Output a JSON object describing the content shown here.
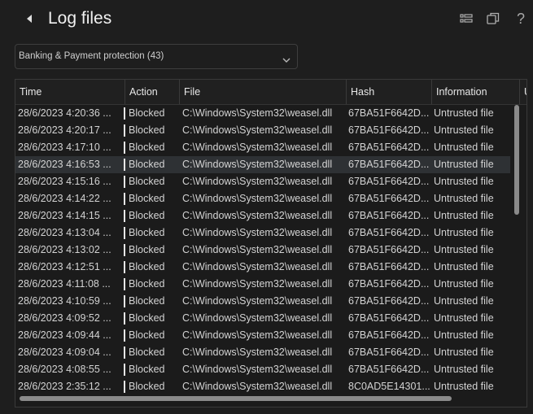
{
  "header": {
    "title": "Log files",
    "icons": [
      "back-arrow-icon",
      "list-view-icon",
      "popout-window-icon",
      "help-icon"
    ],
    "help_glyph": "?"
  },
  "filter": {
    "selected": "Banking & Payment protection (43)"
  },
  "table": {
    "columns": [
      "Time",
      "Action",
      "File",
      "Hash",
      "Information",
      "U"
    ],
    "selected_row_index": 3,
    "rows": [
      {
        "time": "28/6/2023 4:20:36 ...",
        "action": "Blocked",
        "file": "C:\\Windows\\System32\\weasel.dll",
        "hash": "67BA51F6642D...",
        "info": "Untrusted file"
      },
      {
        "time": "28/6/2023 4:20:17 ...",
        "action": "Blocked",
        "file": "C:\\Windows\\System32\\weasel.dll",
        "hash": "67BA51F6642D...",
        "info": "Untrusted file"
      },
      {
        "time": "28/6/2023 4:17:10 ...",
        "action": "Blocked",
        "file": "C:\\Windows\\System32\\weasel.dll",
        "hash": "67BA51F6642D...",
        "info": "Untrusted file"
      },
      {
        "time": "28/6/2023 4:16:53 ...",
        "action": "Blocked",
        "file": "C:\\Windows\\System32\\weasel.dll",
        "hash": "67BA51F6642D...",
        "info": "Untrusted file"
      },
      {
        "time": "28/6/2023 4:15:16 ...",
        "action": "Blocked",
        "file": "C:\\Windows\\System32\\weasel.dll",
        "hash": "67BA51F6642D...",
        "info": "Untrusted file"
      },
      {
        "time": "28/6/2023 4:14:22 ...",
        "action": "Blocked",
        "file": "C:\\Windows\\System32\\weasel.dll",
        "hash": "67BA51F6642D...",
        "info": "Untrusted file"
      },
      {
        "time": "28/6/2023 4:14:15 ...",
        "action": "Blocked",
        "file": "C:\\Windows\\System32\\weasel.dll",
        "hash": "67BA51F6642D...",
        "info": "Untrusted file"
      },
      {
        "time": "28/6/2023 4:13:04 ...",
        "action": "Blocked",
        "file": "C:\\Windows\\System32\\weasel.dll",
        "hash": "67BA51F6642D...",
        "info": "Untrusted file"
      },
      {
        "time": "28/6/2023 4:13:02 ...",
        "action": "Blocked",
        "file": "C:\\Windows\\System32\\weasel.dll",
        "hash": "67BA51F6642D...",
        "info": "Untrusted file"
      },
      {
        "time": "28/6/2023 4:12:51 ...",
        "action": "Blocked",
        "file": "C:\\Windows\\System32\\weasel.dll",
        "hash": "67BA51F6642D...",
        "info": "Untrusted file"
      },
      {
        "time": "28/6/2023 4:11:08 ...",
        "action": "Blocked",
        "file": "C:\\Windows\\System32\\weasel.dll",
        "hash": "67BA51F6642D...",
        "info": "Untrusted file"
      },
      {
        "time": "28/6/2023 4:10:59 ...",
        "action": "Blocked",
        "file": "C:\\Windows\\System32\\weasel.dll",
        "hash": "67BA51F6642D...",
        "info": "Untrusted file"
      },
      {
        "time": "28/6/2023 4:09:52 ...",
        "action": "Blocked",
        "file": "C:\\Windows\\System32\\weasel.dll",
        "hash": "67BA51F6642D...",
        "info": "Untrusted file"
      },
      {
        "time": "28/6/2023 4:09:44 ...",
        "action": "Blocked",
        "file": "C:\\Windows\\System32\\weasel.dll",
        "hash": "67BA51F6642D...",
        "info": "Untrusted file"
      },
      {
        "time": "28/6/2023 4:09:04 ...",
        "action": "Blocked",
        "file": "C:\\Windows\\System32\\weasel.dll",
        "hash": "67BA51F6642D...",
        "info": "Untrusted file"
      },
      {
        "time": "28/6/2023 4:08:55 ...",
        "action": "Blocked",
        "file": "C:\\Windows\\System32\\weasel.dll",
        "hash": "67BA51F6642D...",
        "info": "Untrusted file"
      },
      {
        "time": "28/6/2023 2:35:12 ...",
        "action": "Blocked",
        "file": "C:\\Windows\\System32\\weasel.dll",
        "hash": "8C0AD5E14301...",
        "info": "Untrusted file"
      }
    ]
  },
  "colors": {
    "background": "#1e1e1e",
    "text": "#dcdcdc",
    "selected_row": "#2e3134",
    "scrollbar": "#8a8a8a",
    "border": "#3a3a3a"
  }
}
